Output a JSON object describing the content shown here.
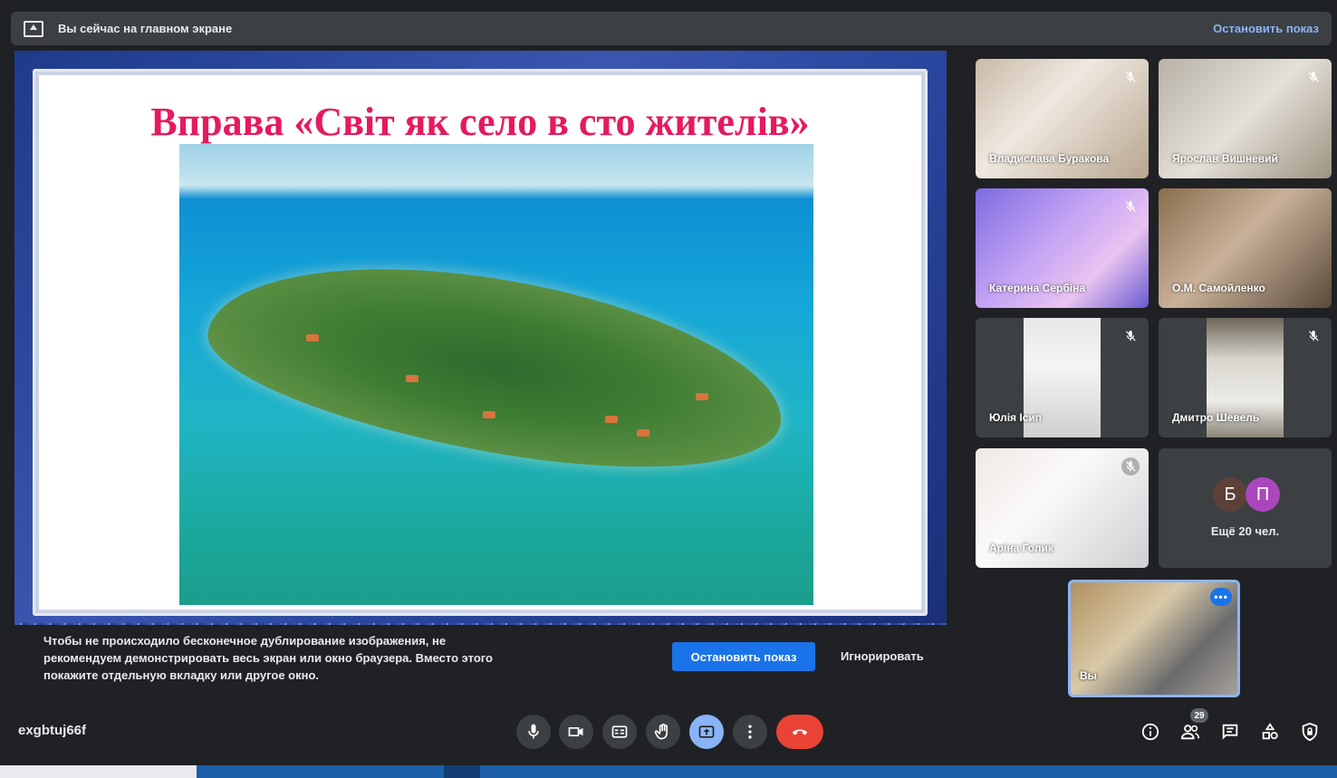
{
  "top_banner": {
    "text": "Вы сейчас на главном экране",
    "stop_label": "Остановить показ"
  },
  "slide": {
    "title": "Вправа «Світ як село в сто жителів»"
  },
  "warning": {
    "text": "Чтобы не происходило бесконечное дублирование изображения, не рекомендуем демонстрировать весь экран или окно браузера. Вместо этого покажите отдельную вкладку или другое окно.",
    "stop_button": "Остановить показ",
    "ignore_button": "Игнорировать"
  },
  "participants": [
    {
      "name": "Владислава Буракова",
      "muted": true
    },
    {
      "name": "Ярослав Вишневий",
      "muted": true
    },
    {
      "name": "Катерина Сербіна",
      "muted": true
    },
    {
      "name": "О.М. Самойленко",
      "muted": false
    },
    {
      "name": "Юлія Ісип",
      "muted": true
    },
    {
      "name": "Дмитро Шевель",
      "muted": true
    },
    {
      "name": "Аріна Голик",
      "muted": true
    }
  ],
  "overflow_tile": {
    "avatars": [
      {
        "letter": "Б",
        "color": "#5d4037"
      },
      {
        "letter": "П",
        "color": "#ab47bc"
      }
    ],
    "label": "Ещё 20 чел."
  },
  "self_tile": {
    "name": "Вы",
    "more": "•••"
  },
  "bottom_bar": {
    "meeting_code": "exgbtuj66f",
    "participants_count": "29"
  },
  "colors": {
    "accent": "#8ab4f8",
    "primary_button": "#1a73e8",
    "end_call": "#ea4335",
    "slide_title": "#e6195f"
  }
}
